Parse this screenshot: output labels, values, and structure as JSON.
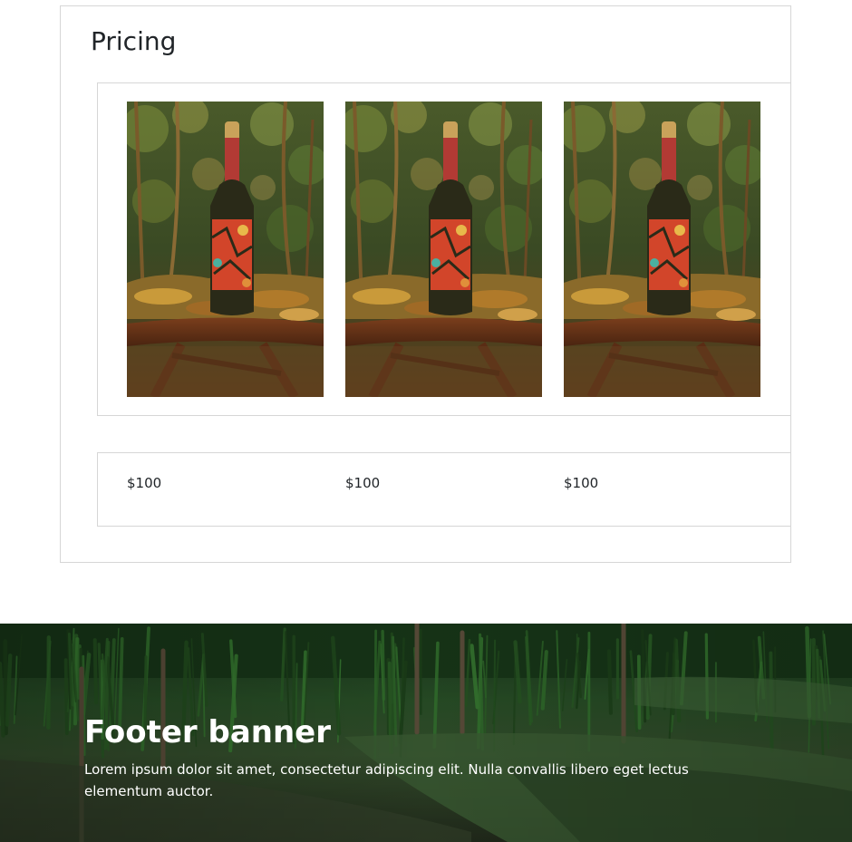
{
  "pricing": {
    "title": "Pricing",
    "products": [
      {
        "image": "wine-bottle-on-table-photo",
        "price": "$100"
      },
      {
        "image": "wine-bottle-on-table-photo",
        "price": "$100"
      },
      {
        "image": "wine-bottle-on-table-photo",
        "price": "$100"
      }
    ]
  },
  "footer": {
    "title": "Footer banner",
    "text": "Lorem ipsum dolor sit amet, consectetur adipiscing elit. Nulla convallis libero eget lectus elementum auctor.",
    "background": "vegetable-field-photo"
  },
  "colors": {
    "border": "#d6d6d6",
    "text": "#212529",
    "footer_text": "#ffffff"
  }
}
